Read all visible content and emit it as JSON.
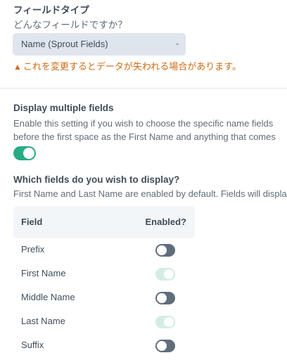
{
  "field_type": {
    "label": "フィールドタイプ",
    "help": "どんなフィールドですか？",
    "selected": "Name (Sprout Fields)",
    "warning": "これを変更するとデータが失われる場合があります。",
    "warning_icon": "warning-triangle-icon"
  },
  "display_multiple": {
    "label": "Display multiple fields",
    "help_line1": "Enable this setting if you wish to choose the specific name fields",
    "help_line2": "before the first space as the First Name and anything that comes",
    "enabled": true
  },
  "which_fields": {
    "label": "Which fields do you wish to display?",
    "help": "First Name and Last Name are enabled by default. Fields will display",
    "columns": [
      "Field",
      "Enabled?"
    ],
    "rows": [
      {
        "name": "Prefix",
        "enabled": false,
        "locked": false
      },
      {
        "name": "First Name",
        "enabled": true,
        "locked": true
      },
      {
        "name": "Middle Name",
        "enabled": false,
        "locked": false
      },
      {
        "name": "Last Name",
        "enabled": true,
        "locked": true
      },
      {
        "name": "Suffix",
        "enabled": false,
        "locked": false
      }
    ]
  },
  "colors": {
    "accent_on": "#27ab83",
    "warning": "#cf6a12",
    "text": "#3f4d5a"
  }
}
